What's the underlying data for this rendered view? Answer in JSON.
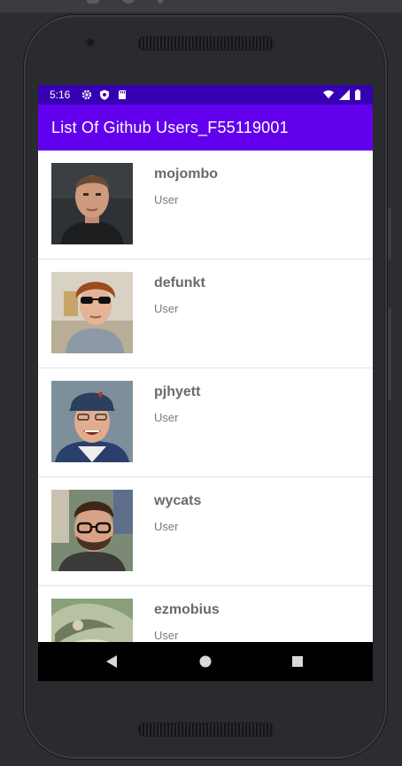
{
  "status_bar": {
    "time": "5:16",
    "left_icons": [
      "gear-icon",
      "shield-icon",
      "sd-card-icon"
    ],
    "right_icons": [
      "wifi-icon",
      "signal-icon",
      "battery-icon"
    ]
  },
  "app_bar": {
    "title": "List Of Github Users_F55119001",
    "color": "#6200ee",
    "status_color": "#3700b3"
  },
  "users": [
    {
      "login": "mojombo",
      "type": "User",
      "avatar": "avatar-mojombo"
    },
    {
      "login": "defunkt",
      "type": "User",
      "avatar": "avatar-defunkt"
    },
    {
      "login": "pjhyett",
      "type": "User",
      "avatar": "avatar-pjhyett"
    },
    {
      "login": "wycats",
      "type": "User",
      "avatar": "avatar-wycats"
    },
    {
      "login": "ezmobius",
      "type": "User",
      "avatar": "avatar-ezmobius"
    }
  ],
  "nav_bar": {
    "buttons": [
      "back-icon",
      "home-icon",
      "recents-icon"
    ]
  }
}
